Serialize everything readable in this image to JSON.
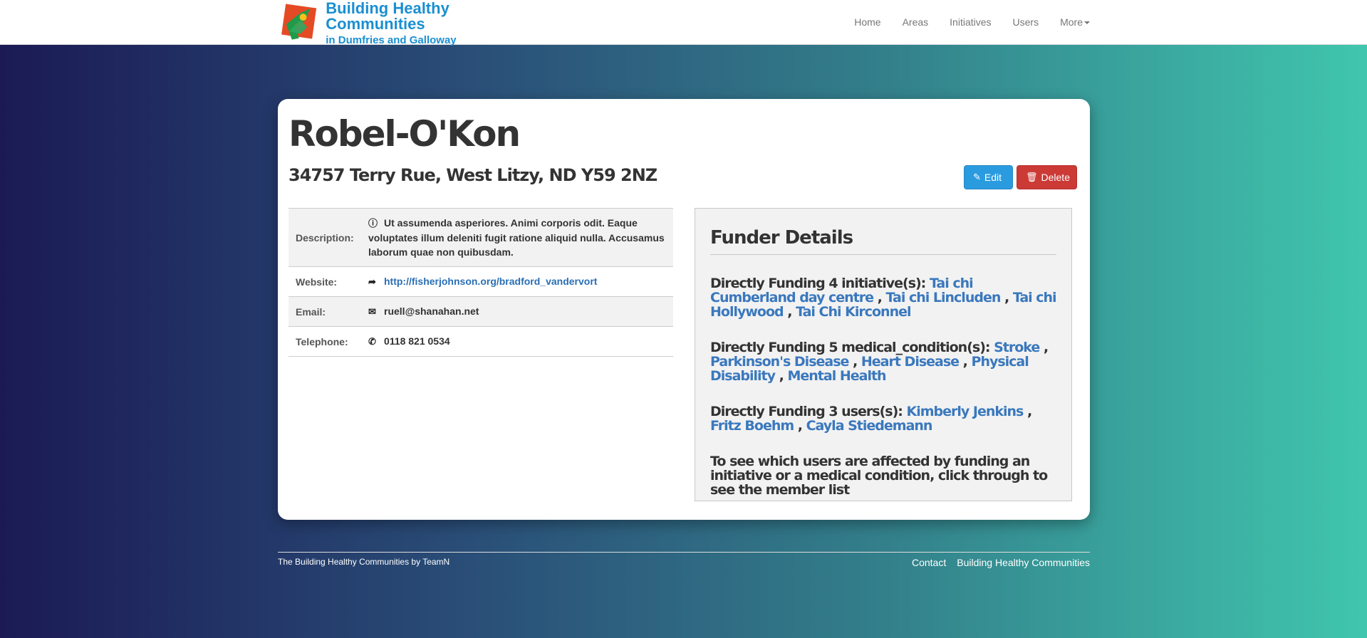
{
  "brand": {
    "title": "Building Healthy Communities",
    "subtitle": "in Dumfries and Galloway"
  },
  "nav": {
    "home": "Home",
    "areas": "Areas",
    "initiatives": "Initiatives",
    "users": "Users",
    "more": "More"
  },
  "org": {
    "name": "Robel-O'Kon",
    "address": "34757 Terry Rue, West Litzy, ND Y59 2NZ"
  },
  "actions": {
    "edit": "Edit",
    "delete": "Delete"
  },
  "details": {
    "description_label": "Description:",
    "description_value": "Ut assumenda asperiores. Animi corporis odit. Eaque voluptates illum deleniti fugit ratione aliquid nulla. Accusamus laborum quae non quibusdam.",
    "website_label": "Website:",
    "website_value": "http://fisherjohnson.org/bradford_vandervort",
    "email_label": "Email:",
    "email_value": "ruell@shanahan.net",
    "telephone_label": "Telephone:",
    "telephone_value": "0118 821 0534"
  },
  "funder": {
    "title": "Funder Details",
    "initiatives_prefix": "Directly Funding 4 initiative(s):",
    "initiatives": [
      "Tai chi Cumberland day centre",
      "Tai chi Lincluden",
      "Tai chi Hollywood",
      "Tai Chi Kirconnel"
    ],
    "conditions_prefix": "Directly Funding 5 medical_condition(s):",
    "conditions": [
      "Stroke",
      "Parkinson's Disease",
      "Heart Disease",
      "Physical Disability",
      "Mental Health"
    ],
    "users_prefix": "Directly Funding 3 users(s):",
    "users": [
      "Kimberly Jenkins",
      "Fritz Boehm",
      "Cayla Stiedemann"
    ],
    "separator": " , ",
    "note": "To see which users are affected by funding an initiative or a medical condition, click through to see the member list"
  },
  "footer": {
    "credit": "The Building Healthy Communities by TeamN",
    "contact": "Contact",
    "site": "Building Healthy Communities"
  },
  "colors": {
    "accent": "#2b9be0",
    "danger": "#cc3a36",
    "link": "#3a78bd",
    "brand": "#1a8fd1"
  }
}
